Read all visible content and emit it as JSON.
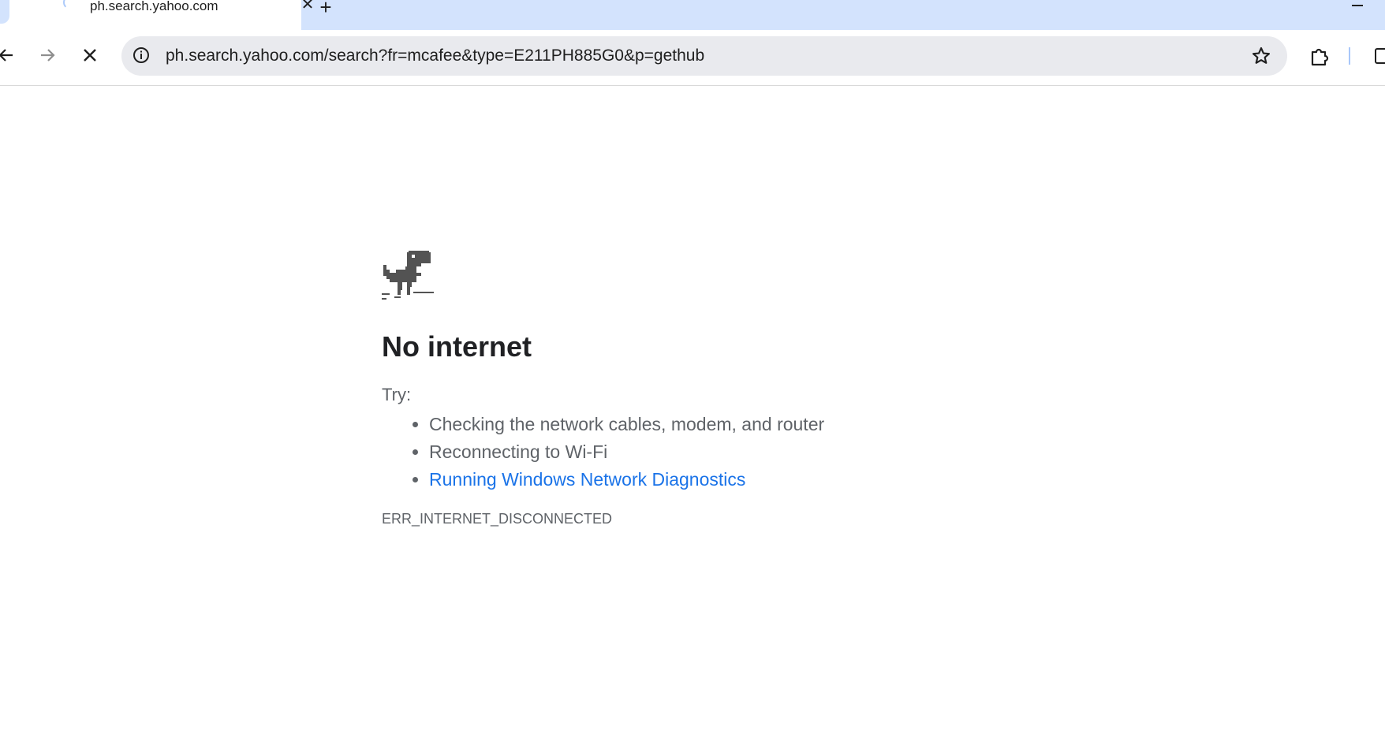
{
  "tab": {
    "title": "ph.search.yahoo.com",
    "close_symbol": "✕",
    "new_tab_symbol": "+"
  },
  "toolbar": {
    "url": "ph.search.yahoo.com/search?fr=mcafee&type=E211PH885G0&p=gethub"
  },
  "icons": {
    "back": "back-arrow-icon",
    "forward": "forward-arrow-icon",
    "stop": "stop-loading-icon",
    "site_info": "info-icon",
    "bookmark": "star-icon",
    "extensions": "puzzle-piece-icon"
  },
  "error_page": {
    "title": "No internet",
    "try_label": "Try:",
    "suggestions": [
      "Checking the network cables, modem, and router",
      "Reconnecting to Wi-Fi",
      "Running Windows Network Diagnostics"
    ],
    "error_code": "ERR_INTERNET_DISCONNECTED"
  },
  "colors": {
    "tabstrip": "#d3e3fd",
    "omnibox": "#e9eaee",
    "link": "#1a73e8",
    "text_secondary": "#5f6368"
  }
}
